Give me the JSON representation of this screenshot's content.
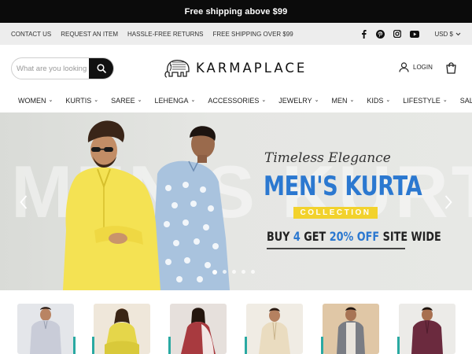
{
  "announcement": "Free shipping above $99",
  "utility": {
    "links": [
      "CONTACT US",
      "REQUEST AN ITEM",
      "HASSLE-FREE RETURNS",
      "FREE SHIPPING OVER $99"
    ],
    "social": [
      "facebook-icon",
      "pinterest-icon",
      "instagram-icon",
      "youtube-icon"
    ],
    "currency": "USD $"
  },
  "header": {
    "search_placeholder": "What are you looking for?",
    "brand": "KARMAPLACE",
    "login": "LOGIN"
  },
  "nav": [
    "WOMEN",
    "KURTIS",
    "SAREE",
    "LEHENGA",
    "ACCESSORIES",
    "JEWELRY",
    "MEN",
    "KIDS",
    "LIFESTYLE",
    "SALE"
  ],
  "hero": {
    "ghost_text": "MEN'S KURTA",
    "script": "Timeless Elegance",
    "headline": "MEN'S KURTA",
    "pill": "COLLECTION",
    "offer_a": "BUY ",
    "offer_b": "4",
    "offer_c": " GET ",
    "offer_d": "20% OFF",
    "offer_e": " SITE WIDE",
    "slides": 5,
    "active_slide": 1
  },
  "colors": {
    "accent_blue": "#2b78d0",
    "pill_yellow": "#f2d22d",
    "teal": "#2aa9a2"
  }
}
